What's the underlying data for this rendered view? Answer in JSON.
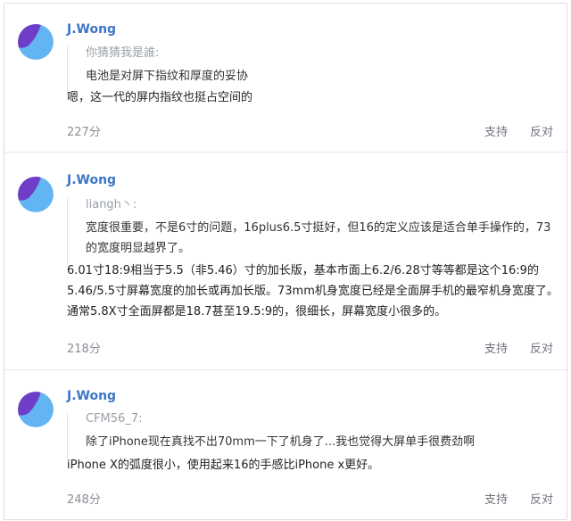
{
  "comments": [
    {
      "username": "J.Wong",
      "quote_author": "你猜猜我是誰:",
      "quote_text": "电池是对屏下指纹和厚度的妥协",
      "body": "嗯，这一代的屏内指纹也挺占空间的",
      "score": "227分",
      "support": "支持",
      "oppose": "反对"
    },
    {
      "username": "J.Wong",
      "quote_author": "liangh丶:",
      "quote_text": "宽度很重要，不是6寸的问题，16plus6.5寸挺好，但16的定义应该是适合单手操作的，73的宽度明显越界了。",
      "body": "6.01寸18:9相当于5.5（非5.46）寸的加长版，基本市面上6.2/6.28寸等等都是这个16:9的5.46/5.5寸屏幕宽度的加长或再加长版。73mm机身宽度已经是全面屏手机的最窄机身宽度了。通常5.8X寸全面屏都是18.7甚至19.5:9的，很细长，屏幕宽度小很多的。",
      "score": "218分",
      "support": "支持",
      "oppose": "反对"
    },
    {
      "username": "J.Wong",
      "quote_author": "CFM56_7:",
      "quote_text": "除了iPhone现在真找不出70mm一下了机身了...我也觉得大屏单手很费劲啊",
      "body": "iPhone X的弧度很小，使用起来16的手感比iPhone x更好。",
      "score": "248分",
      "support": "支持",
      "oppose": "反对"
    }
  ],
  "colors": {
    "username": "#3d75c5",
    "avatar_blue": "#63b4f2",
    "avatar_purple": "#6f3ec8"
  }
}
